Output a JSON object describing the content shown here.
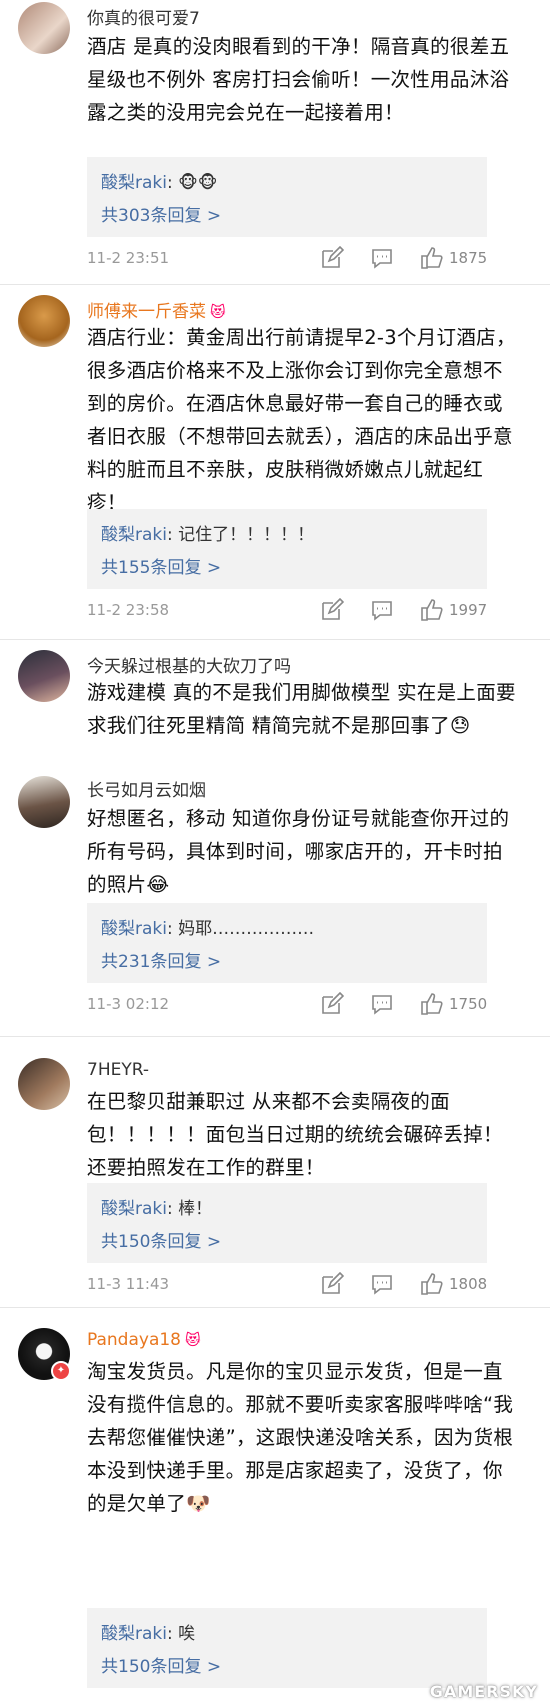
{
  "comments": [
    {
      "name": "你真的很可爱7",
      "text": "酒店 是真的没肉眼看到的干净！隔音真的很差五星级也不例外 客房打扫会偷听！一次性用品沐浴露之类的没用完会兑在一起接着用！",
      "reply_user": "酸梨raki",
      "reply_text": ": 🐵🐵",
      "reply_count": "共303条回复 >",
      "time": "11-2 23:51",
      "likes": "1875"
    },
    {
      "name": "师傅来一斤香菜",
      "badge": "😻",
      "text": "酒店行业：黄金周出行前请提早2-3个月订酒店，很多酒店价格来不及上涨你会订到你完全意想不到的房价。在酒店休息最好带一套自己的睡衣或者旧衣服（不想带回去就丢），酒店的床品出乎意料的脏而且不亲肤，皮肤稍微娇嫩点儿就起红疹！",
      "reply_user": "酸梨raki",
      "reply_text": ": 记住了！！！！！",
      "reply_count": "共155条回复 >",
      "time": "11-2 23:58",
      "likes": "1997"
    },
    {
      "name": "今天躲过根基的大砍刀了吗",
      "text": "游戏建模 真的不是我们用脚做模型 实在是上面要求我们往死里精简 精简完就不是那回事了😓"
    },
    {
      "name": "长弓如月云如烟",
      "text": "好想匿名，移动 知道你身份证号就能查你开过的所有号码，具体到时间，哪家店开的，开卡时拍的照片😂",
      "reply_user": "酸梨raki",
      "reply_text": ": 妈耶………………",
      "reply_count": "共231条回复 >",
      "time": "11-3 02:12",
      "likes": "1750"
    },
    {
      "name": "7HEYR-",
      "text": "在巴黎贝甜兼职过 从来都不会卖隔夜的面包！！！！！面包当日过期的统统会碾碎丢掉！还要拍照发在工作的群里！",
      "reply_user": "酸梨raki",
      "reply_text": ": 棒！",
      "reply_count": "共150条回复 >",
      "time": "11-3 11:43",
      "likes": "1808"
    },
    {
      "name": "Pandaya18",
      "badge": "😻",
      "text": "淘宝发货员。凡是你的宝贝显示发货，但是一直没有揽件信息的。那就不要听卖家客服哔哔啥“我去帮您催催快递”，这跟快递没啥关系，因为货根本没到快递手里。那是店家超卖了，没货了，你的是欠单了🐶",
      "reply_user": "酸梨raki",
      "reply_text": ": 唉",
      "reply_count": "共150条回复 >"
    }
  ],
  "watermark": "GAMERSKY",
  "icons": {
    "edit": "edit-icon",
    "comment": "comment-icon",
    "like": "like-icon"
  },
  "colors": {
    "link": "#466da3",
    "vip_name": "#e8771f",
    "reply_bg": "#f2f2f2"
  }
}
